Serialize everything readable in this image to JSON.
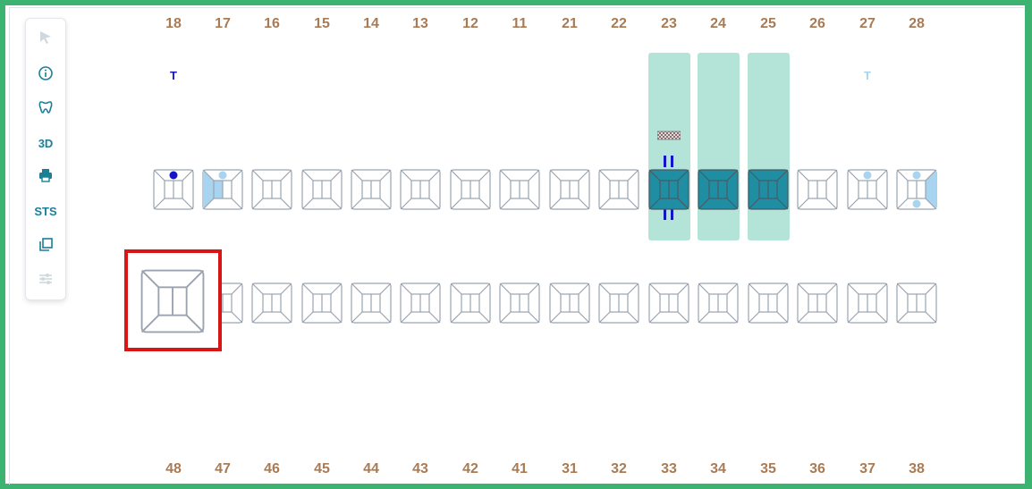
{
  "upper_numbers": [
    "18",
    "17",
    "16",
    "15",
    "14",
    "13",
    "12",
    "11",
    "21",
    "22",
    "23",
    "24",
    "25",
    "26",
    "27",
    "28"
  ],
  "lower_numbers": [
    "48",
    "47",
    "46",
    "45",
    "44",
    "43",
    "42",
    "41",
    "31",
    "32",
    "33",
    "34",
    "35",
    "36",
    "37",
    "38"
  ],
  "toolbar": {
    "tools": [
      {
        "name": "pointer-tool",
        "icon": "cursor-icon",
        "disabled": true
      },
      {
        "name": "info-tool",
        "icon": "info-icon",
        "disabled": false
      },
      {
        "name": "tooth-tool",
        "icon": "tooth-icon",
        "disabled": false
      },
      {
        "name": "3d-tool",
        "label": "3D",
        "disabled": false
      },
      {
        "name": "print-tool",
        "icon": "printer-icon",
        "disabled": false
      },
      {
        "name": "sts-tool",
        "label": "STS",
        "disabled": false
      },
      {
        "name": "copy-tool",
        "icon": "copy-icon",
        "disabled": false
      },
      {
        "name": "settings-tool",
        "icon": "sliders-icon",
        "disabled": true
      }
    ]
  },
  "markers": {
    "tooth_18": "T",
    "tooth_27": "T"
  },
  "colors": {
    "background_frame": "#3cb371",
    "number_color": "#a97b55",
    "accent_teal": "#1a7f97",
    "highlight_column": "#b4e4d7",
    "selected_tooth_fill": "#1f8ea2",
    "partial_fill": "#a8d4f0",
    "dot_dark": "#1414c8",
    "dot_light": "#a8d4f0",
    "selection_red": "#d91515"
  },
  "highlighted_teeth": [
    "23",
    "24",
    "25"
  ],
  "selected_lower_tooth": "48"
}
